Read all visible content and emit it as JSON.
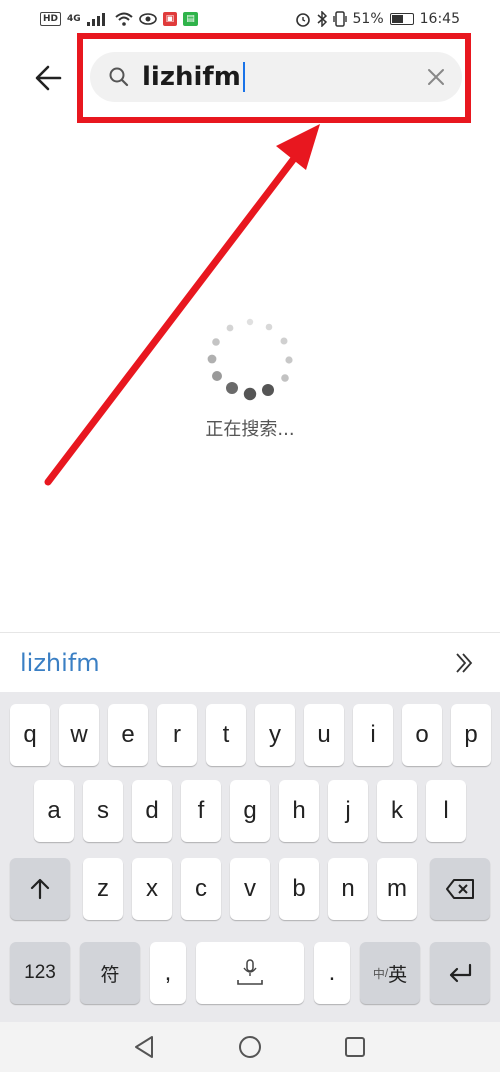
{
  "status_bar": {
    "hd": "HD",
    "signal": "4G",
    "battery_percent": "51%",
    "battery_level": 0.51,
    "time": "16:45"
  },
  "search": {
    "query": "lizhifm",
    "back_icon": "back-arrow-icon",
    "search_icon": "magnifier-icon",
    "clear_icon": "close-icon"
  },
  "loading": {
    "text": "正在搜索..."
  },
  "annotation": {
    "color": "#e8171f"
  },
  "candidate": {
    "text": "lizhifm",
    "expand_icon": "double-chevron-icon",
    "color": "#3a7fc4"
  },
  "keyboard": {
    "row1": [
      "q",
      "w",
      "e",
      "r",
      "t",
      "y",
      "u",
      "i",
      "o",
      "p"
    ],
    "row2": [
      "a",
      "s",
      "d",
      "f",
      "g",
      "h",
      "j",
      "k",
      "l"
    ],
    "row3": [
      "z",
      "x",
      "c",
      "v",
      "b",
      "n",
      "m"
    ],
    "shift_icon": "shift-arrow-icon",
    "backspace_icon": "backspace-icon",
    "num_label": "123",
    "symbol_label": "符",
    "comma": ",",
    "space_icon": "microphone-icon",
    "period": ".",
    "lang_small": "中",
    "lang_main": "英",
    "enter_icon": "enter-icon"
  },
  "nav": {
    "back_icon": "triangle-back-icon",
    "home_icon": "circle-home-icon",
    "recent_icon": "square-recent-icon"
  }
}
